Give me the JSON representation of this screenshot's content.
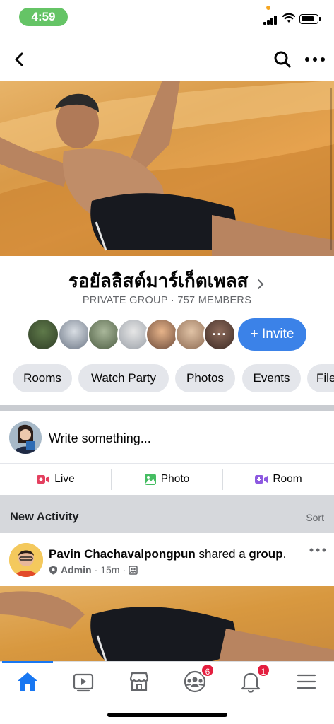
{
  "status_bar": {
    "time": "4:59",
    "icons": [
      "cellular-signal-icon",
      "wifi-icon",
      "battery-icon"
    ]
  },
  "nav": {
    "icons": [
      "back-chevron-icon",
      "search-icon",
      "more-horizontal-icon"
    ]
  },
  "group": {
    "name": "รอยัลลิสต์มาร์เก็ตเพลส",
    "meta": "PRIVATE GROUP · 757 MEMBERS",
    "member_more_label": "···",
    "invite_label": "+ Invite"
  },
  "chips": [
    "Rooms",
    "Watch Party",
    "Photos",
    "Events",
    "Files"
  ],
  "composer": {
    "placeholder": "Write something..."
  },
  "post_actions": [
    {
      "label": "Live",
      "icon": "live-video-icon",
      "color": "#e4405f"
    },
    {
      "label": "Photo",
      "icon": "photo-icon",
      "color": "#45bd62"
    },
    {
      "label": "Room",
      "icon": "room-video-icon",
      "color": "#8d59e0"
    }
  ],
  "activity": {
    "title": "New Activity",
    "sort_label": "Sort"
  },
  "post": {
    "author": "Pavin Chachavalpongpun",
    "action": " shared a ",
    "object": "group",
    "punct": ".",
    "role": "Admin",
    "time": "15m",
    "separator": "·"
  },
  "tab_bar": {
    "tabs": [
      {
        "icon": "home-icon",
        "active": true
      },
      {
        "icon": "watch-video-icon",
        "active": false
      },
      {
        "icon": "marketplace-icon",
        "active": false
      },
      {
        "icon": "groups-icon",
        "active": false,
        "badge": "6"
      },
      {
        "icon": "notifications-bell-icon",
        "active": false,
        "badge": "1"
      },
      {
        "icon": "menu-icon",
        "active": false
      }
    ]
  },
  "colors": {
    "accent": "#1877f2",
    "invite": "#3b82e8",
    "badge": "#e41e3f",
    "status_pill": "#65c466"
  }
}
